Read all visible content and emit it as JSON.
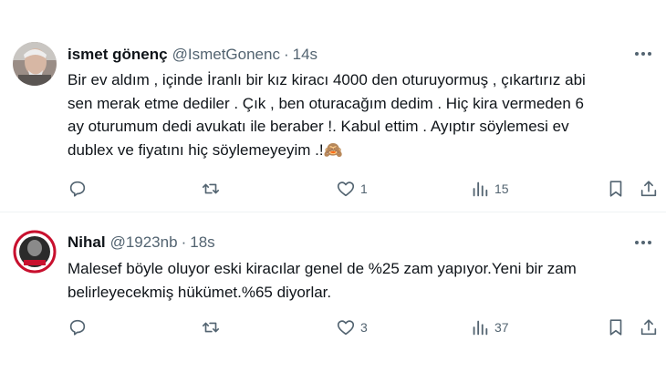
{
  "tweets": [
    {
      "author_name": "ismet gönenç",
      "handle": "@IsmetGonenc",
      "separator": "·",
      "time": "14s",
      "lines": [
        "Bir ev aldım , içinde İranlı bir kız kiracı 4000 den oturuyormuş , çıkartırız abi",
        "sen merak etme dediler . Çık , ben oturacağım dedim . Hiç kira vermeden 6",
        "ay oturumum dedi avukatı ile beraber !. Kabul ettim . Ayıptır söylemesi ev",
        "dublex ve fiyatını hiç söylemeyeyim .!🙈"
      ],
      "reply_count": "",
      "retweet_count": "",
      "like_count": "1",
      "view_count": "15"
    },
    {
      "author_name": "Nihal",
      "handle": "@1923nb",
      "separator": "·",
      "time": "18s",
      "lines": [
        "Malesef böyle oluyor eski kiracılar genel de %25 zam yapıyor.Yeni bir zam",
        "belirleyecekmiş hükümet.%65 diyorlar."
      ],
      "reply_count": "",
      "retweet_count": "",
      "like_count": "3",
      "view_count": "37"
    }
  ],
  "colors": {
    "text_primary": "#0f1419",
    "text_secondary": "#536471",
    "divider": "#eff3f4"
  },
  "icons": [
    "avatar",
    "more-icon",
    "reply-icon",
    "retweet-icon",
    "like-icon",
    "views-icon",
    "bookmark-icon",
    "share-icon"
  ]
}
